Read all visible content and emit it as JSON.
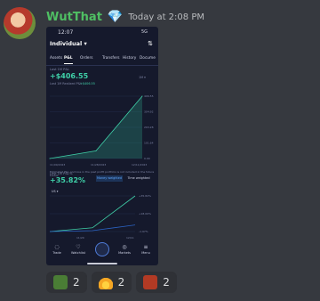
{
  "message": {
    "username": "WutThat",
    "badge_icon": "diamond-icon",
    "timestamp": "Today at 2:08 PM"
  },
  "phone": {
    "status_time": "12:07",
    "status_signal": "5G",
    "account_label": "Individual ▾",
    "tabs": [
      "Assets",
      "P&L",
      "Orders",
      "Transfers",
      "History",
      "Docume"
    ],
    "active_tab": "P&L",
    "pnl": {
      "label": "Last 1M P&L",
      "value": "+$406.55",
      "sub_label": "Last 1M Realized P&L",
      "sub_value": "+$406.55",
      "period": "1M ▾",
      "x_ticks": [
        "11/09/2023",
        "11/28/2023",
        "12/11/2023"
      ],
      "y_ticks": [
        "406.55",
        "304.92",
        "203.28",
        "101.64",
        "0.00"
      ],
      "note": "Estimated P&L and loss in the past profit portfolio is not included in the future trades"
    },
    "pnl_ratio": {
      "label": "Last 1M P&L%",
      "value": "+35.82%",
      "toggle_active": "Money weighted",
      "toggle_inactive": "Time weighted",
      "legend": "US ▾",
      "y_ticks": [
        "+35.82%",
        "+18.00%",
        "-1.97%"
      ],
      "x_ticks": [
        "11/20",
        "12/11"
      ]
    },
    "nav": [
      {
        "label": "Trade",
        "icon": "chat-icon"
      },
      {
        "label": "Watchlist",
        "icon": "heart-icon"
      },
      {
        "label": "",
        "icon": "moomoo-logo-icon"
      },
      {
        "label": "Markets",
        "icon": "globe-icon"
      },
      {
        "label": "Menu",
        "icon": "menu-icon"
      }
    ]
  },
  "reactions": [
    {
      "emoji": "frog-emoji",
      "count": "2",
      "color": "#4a7d35"
    },
    {
      "emoji": "fire-emoji",
      "count": "2",
      "color": "#f5a623"
    },
    {
      "emoji": "fire-lady-emoji",
      "count": "2",
      "color": "#b23a24"
    }
  ],
  "chart_data": [
    {
      "type": "area",
      "x": [
        "11/09/2023",
        "11/28/2023",
        "12/11/2023"
      ],
      "values": [
        0,
        50,
        406.55
      ],
      "ylim": [
        0,
        406.55
      ],
      "ylabel": "",
      "title": ""
    },
    {
      "type": "line",
      "x": [
        "11/20",
        "12/11"
      ],
      "series": [
        {
          "values": [
            -1.97,
            2.0,
            35.82
          ],
          "color": "#3fd0a8"
        },
        {
          "values": [
            -1.97,
            -1.0,
            5.0
          ],
          "color": "#2b62c2"
        }
      ],
      "ylim": [
        -1.97,
        35.82
      ],
      "title": ""
    }
  ]
}
